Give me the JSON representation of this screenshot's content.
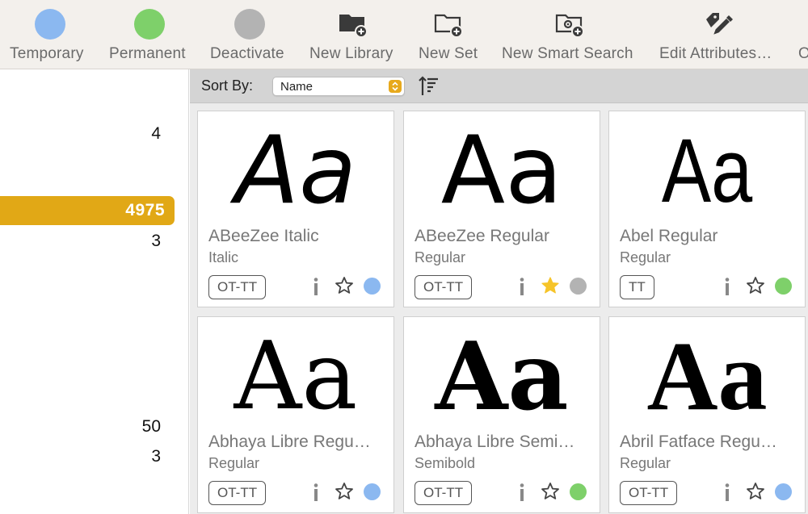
{
  "toolbar": {
    "items": [
      {
        "label": "Temporary",
        "icon": "blue-circle-icon",
        "color": "#8bb8f0"
      },
      {
        "label": "Permanent",
        "icon": "green-circle-icon",
        "color": "#7ed06a"
      },
      {
        "label": "Deactivate",
        "icon": "gray-circle-icon",
        "color": "#b3b3b3"
      },
      {
        "label": "New Library",
        "icon": "new-library-icon"
      },
      {
        "label": "New Set",
        "icon": "new-set-icon"
      },
      {
        "label": "New Smart Search",
        "icon": "new-smart-search-icon"
      },
      {
        "label": "Edit Attributes…",
        "icon": "edit-attributes-icon"
      },
      {
        "label": "O",
        "icon": ""
      }
    ]
  },
  "sidebar": {
    "counts": [
      "4",
      "4975",
      "3",
      "50",
      "3"
    ],
    "selected_color": "#e1a816"
  },
  "sortbar": {
    "label": "Sort By:",
    "value": "Name",
    "direction_icon": "sort-ascending-icon"
  },
  "fonts": [
    {
      "name": "ABeeZee Italic",
      "style": "Italic",
      "format": "OT-TT",
      "favorite": false,
      "status_color": "#8bb8f0"
    },
    {
      "name": "ABeeZee Regular",
      "style": "Regular",
      "format": "OT-TT",
      "favorite": true,
      "status_color": "#b3b3b3"
    },
    {
      "name": "Abel Regular",
      "style": "Regular",
      "format": "TT",
      "favorite": false,
      "status_color": "#7ed06a"
    },
    {
      "name": "Abhaya Libre Regu…",
      "style": "Regular",
      "format": "OT-TT",
      "favorite": false,
      "status_color": "#8bb8f0"
    },
    {
      "name": "Abhaya Libre Semi…",
      "style": "Semibold",
      "format": "OT-TT",
      "favorite": false,
      "status_color": "#7ed06a"
    },
    {
      "name": "Abril Fatface Regu…",
      "style": "Regular",
      "format": "OT-TT",
      "favorite": false,
      "status_color": "#8bb8f0"
    }
  ],
  "preview_text": "Aa",
  "colors": {
    "accent": "#e1a816",
    "star_filled": "#f6c429"
  }
}
